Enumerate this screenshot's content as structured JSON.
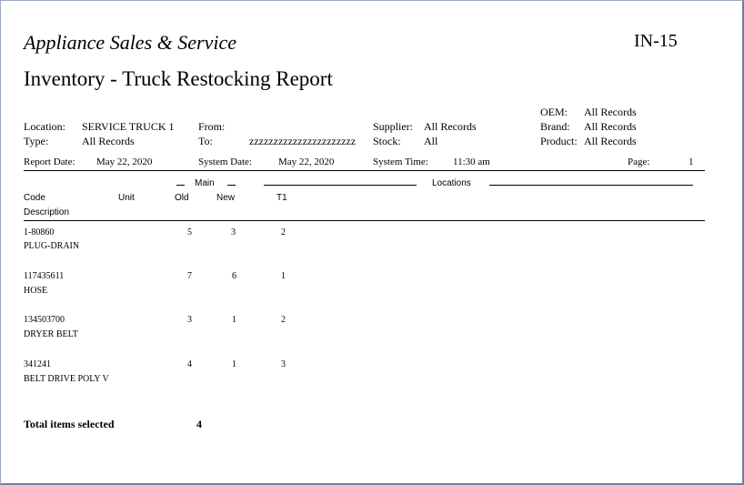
{
  "header": {
    "company": "Appliance Sales & Service",
    "report_code": "IN-15",
    "title": "Inventory - Truck Restocking Report"
  },
  "filters": {
    "location_label": "Location:",
    "location_value": "SERVICE TRUCK 1",
    "type_label": "Type:",
    "type_value": "All Records",
    "from_label": "From:",
    "from_value": "",
    "to_label": "To:",
    "to_value": "zzzzzzzzzzzzzzzzzzzzzz",
    "supplier_label": "Supplier:",
    "supplier_value": "All Records",
    "stock_label": "Stock:",
    "stock_value": "All",
    "oem_label": "OEM:",
    "oem_value": "All Records",
    "brand_label": "Brand:",
    "brand_value": "All Records",
    "product_label": "Product:",
    "product_value": "All Records"
  },
  "report_info": {
    "report_date_label": "Report Date:",
    "report_date": "May 22, 2020",
    "system_date_label": "System Date:",
    "system_date": "May 22, 2020",
    "system_time_label": "System Time:",
    "system_time": "11:30 am",
    "page_label": "Page:",
    "page": "1"
  },
  "columns": {
    "main_group": "Main",
    "locations_group": "Locations",
    "code": "Code",
    "description": "Description",
    "unit": "Unit",
    "old": "Old",
    "new": "New",
    "t1": "T1"
  },
  "items": [
    {
      "code": "1-80860",
      "description": "PLUG-DRAIN",
      "old": "5",
      "new": "3",
      "t1": "2"
    },
    {
      "code": "117435611",
      "description": "HOSE",
      "old": "7",
      "new": "6",
      "t1": "1"
    },
    {
      "code": "134503700",
      "description": "DRYER BELT",
      "old": "3",
      "new": "1",
      "t1": "2"
    },
    {
      "code": "341241",
      "description": "BELT DRIVE POLY V",
      "old": "4",
      "new": "1",
      "t1": "3"
    }
  ],
  "summary": {
    "total_label": "Total items selected",
    "total_value": "4"
  }
}
